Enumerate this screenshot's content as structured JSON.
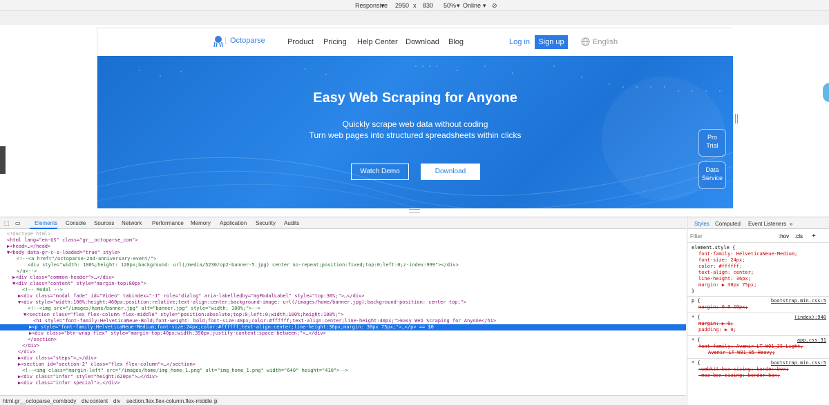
{
  "device_toolbar": {
    "mode": "Responsive",
    "width": "2950",
    "x": "x",
    "height": "830",
    "zoom": "50%",
    "network": "Online"
  },
  "site": {
    "logo_text": "Octoparse",
    "nav": [
      "Product",
      "Pricing",
      "Help Center",
      "Download",
      "Blog"
    ],
    "login": "Log in",
    "signup": "Sign up",
    "language": "English",
    "banner": {
      "title": "Easy Web Scraping for Anyone",
      "subtitle1": "Quickly scrape web data without coding",
      "subtitle2": "Turn web pages into structured spreadsheets within clicks",
      "watch_demo": "Watch Demo",
      "download": "Download",
      "side_tab1": [
        "Pro",
        "Trial"
      ],
      "side_tab2": [
        "Data",
        "Service"
      ]
    }
  },
  "devtools": {
    "tabs": [
      "Elements",
      "Console",
      "Sources",
      "Network",
      "Performance",
      "Memory",
      "Application",
      "Security",
      "Audits"
    ],
    "elements_lines": [
      "<!doctype html>",
      "<html lang=\"en-US\" class=\"gr__octoparse_com\">",
      "▶<head>…</head>",
      "▼<body data-gr-c-s-loaded=\"true\" style>",
      "<!--<a href=\"/octoparse-2nd-anniversary-event/\">",
      "<div style=\"width: 100%;height: 120px;background: url(/media/5230/op2-banner-5.jpg) center no-repeat;position:fixed;top:0;left:0;z-index:999\"></div>",
      "</a>-->",
      "▶<div class=\"common-header\">…</div>",
      "▼<div class=\"content\" style=\"margin-top:80px\">",
      "<!-- Modal -->",
      "▶<div class=\"modal fade\" id=\"Video\" tabindex=\"-1\" role=\"dialog\" aria-labelledby=\"myModalLabel\" style=\"top:30%;\">…</div>",
      "▼<div style=\"width:100%;height:460px;position:relative;text-align:center;background-image: url(/images/home/banner.jpg);background-position: center top;\">",
      "<!--<img src=\"/images/home/banner.jpg\" alt=\"banner.jpg\" style=\"width: 100%;\">-->",
      "▼<section class=\"flex flex-column flex-middle\" style=\"position:absolute;top:0;left:0;width:100%;height:100%;\">",
      "<h1 style=\"font-family:HelveticaNeue-Bold;font-weight: bold;font-size:40px;color:#ffffff;text-align:center;line-height:40px;\">Easy Web Scraping for Anyone</h1>",
      "▶<p style=\"font-family:HelveticaNeue-Medium;font-size:24px;color:#ffffff;text-align:center;line-height:36px;margin: 30px 75px;\">…</p> == $0",
      "▶<div class=\"btn-wrap flex\" style=\"margin-top:40px;width:390px;justify-content:space-between;\">…</div>",
      "</section>",
      "</div>",
      "</div>",
      "▶<div class=\"steps\">…</div>",
      "▶<section id=\"section-2\" class=\"flex flex-column\">…</section>",
      "<!--<img class=\"margin-left\" src=\"/images/home/img_home_1.png\" alt=\"img_home_1.png\" width=\"640\" height=\"410\">-->",
      "▶<div class=\"infor\" style=\"height:620px\">…</div>",
      "▶<div class=\"infor special\">…</div>"
    ],
    "breadcrumbs": [
      "html.gr__octoparse_com",
      "body",
      "div.content",
      "div",
      "section.flex.flex-column.flex-middle",
      "p"
    ],
    "styles_panel": {
      "tabs": [
        "Styles",
        "Computed",
        "Event Listeners",
        "»"
      ],
      "filter_placeholder": "Filter",
      "hov": ":hov",
      "cls": ".cls",
      "plus": "+",
      "element_style": [
        "element.style {",
        "font-family: HelveticaNeue-Medium;",
        "font-size: 24px;",
        "color: #ffffff;",
        "text-align: center;",
        "line-height: 36px;",
        "margin: ▶ 30px 75px;",
        "}"
      ],
      "rule1_selector": "p {",
      "rule1_source": "bootstrap.min.css:5",
      "rule1_prop": "margin: 0 0 10px;",
      "rule2_selector": "* {",
      "rule2_source": "(index):940",
      "rule2_props": [
        "margin: ▶ 0;",
        "padding: ▶ 0;"
      ],
      "rule3_selector": "* {",
      "rule3_source": "app.css:31",
      "rule3_props": [
        "font-family: Avenir LT W01_35 Light,",
        "Avenir LT W01_85 Heavy;"
      ],
      "rule4_selector": "* {",
      "rule4_source": "bootstrap.min.css:5",
      "rule4_props": [
        "-webkit-box-sizing: border-box;",
        "-moz-box-sizing: border-box;"
      ]
    }
  }
}
